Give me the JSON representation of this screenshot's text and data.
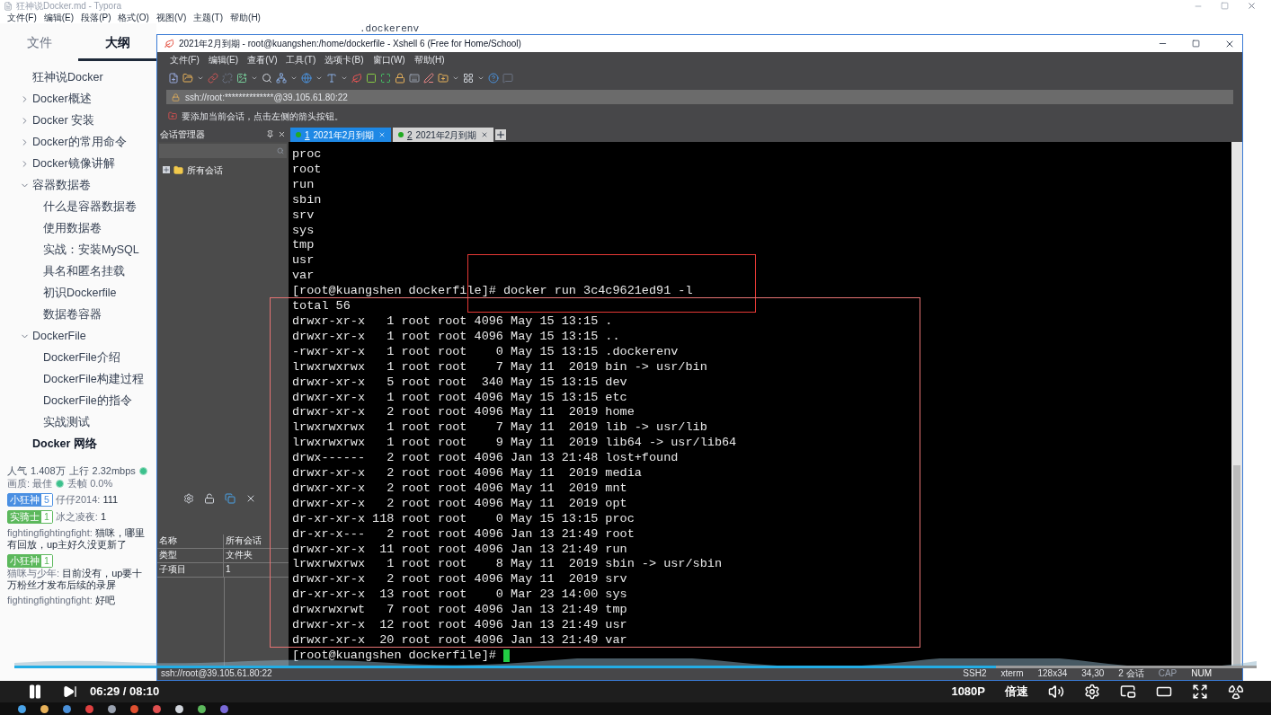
{
  "typora": {
    "title": "狂神说Docker.md - Typora",
    "menu": [
      "文件(F)",
      "编辑(E)",
      "段落(P)",
      "格式(O)",
      "视图(V)",
      "主题(T)",
      "帮助(H)"
    ],
    "sidebar_tabs": [
      {
        "label": "文件",
        "selected": false
      },
      {
        "label": "大纲",
        "selected": true
      }
    ],
    "outline": [
      {
        "label": "狂神说Docker",
        "kind": "heading",
        "selected": false
      },
      {
        "label": "Docker概述",
        "kind": "folder",
        "expanded": false,
        "selected": false
      },
      {
        "label": "Docker 安装",
        "kind": "folder",
        "expanded": false,
        "selected": false
      },
      {
        "label": "Docker的常用命令",
        "kind": "folder",
        "expanded": false,
        "selected": false
      },
      {
        "label": "Docker镜像讲解",
        "kind": "folder",
        "expanded": false,
        "selected": false
      },
      {
        "label": "容器数据卷",
        "kind": "folder",
        "expanded": true,
        "selected": false,
        "children": [
          {
            "label": "什么是容器数据卷",
            "selected": false
          },
          {
            "label": "使用数据卷",
            "selected": false
          },
          {
            "label": "实战：安装MySQL",
            "selected": false
          },
          {
            "label": "具名和匿名挂载",
            "selected": false
          },
          {
            "label": "初识Dockerfile",
            "selected": false
          },
          {
            "label": "数据卷容器",
            "selected": false
          }
        ]
      },
      {
        "label": "DockerFile",
        "kind": "folder",
        "expanded": true,
        "selected": false,
        "children": [
          {
            "label": "DockerFile介绍",
            "selected": false
          },
          {
            "label": "DockerFile构建过程",
            "selected": false
          },
          {
            "label": "DockerFile的指令",
            "selected": false
          },
          {
            "label": "实战测试",
            "selected": false
          }
        ]
      },
      {
        "label": "Docker 网络",
        "kind": "heading",
        "selected": true
      }
    ],
    "content_text": ".dockerenv"
  },
  "live_stats": {
    "popularity_label": "人气",
    "popularity": "1.408万",
    "upload_label": "上行",
    "upload": "2.32mbps",
    "quality": "画质: 最佳",
    "drop": "丢帧 0.0%"
  },
  "chat": [
    {
      "badge": {
        "text": "小狂神",
        "level": "5",
        "color": "#4a8fe2"
      },
      "user": "仔仔2014:",
      "text": "111"
    },
    {
      "badge": {
        "text": "实骑士",
        "level": "1",
        "color": "#5cb85c"
      },
      "user": "冰之凌夜:",
      "text": "1"
    },
    {
      "user": "fightingfightingfight:",
      "text": "猫咪，哪里有回放，up主好久没更新了"
    },
    {
      "badge": {
        "text": "小狂神",
        "level": "1",
        "color": "#5cb85c"
      },
      "user": "猫咪与少年:",
      "text": "目前没有，up要十万粉丝才发布后续的录屏"
    },
    {
      "user": "fightingfightingfight:",
      "text": "好吧"
    }
  ],
  "xshell": {
    "title": "2021年2月到期 - root@kuangshen:/home/dockerfile - Xshell 6 (Free for Home/School)",
    "menu": [
      "文件(F)",
      "编辑(E)",
      "查看(V)",
      "工具(T)",
      "选项卡(B)",
      "窗口(W)",
      "帮助(H)"
    ],
    "address": "ssh://root:**************@39.105.61.80:22",
    "hint": "要添加当前会话，点击左侧的箭头按钮。",
    "session_panel": {
      "title": "会话管理器",
      "tree": [
        {
          "label": "所有会话",
          "expanded": false
        }
      ],
      "properties": [
        {
          "name": "名称",
          "value": "所有会话"
        },
        {
          "name": "类型",
          "value": "文件夹"
        },
        {
          "name": "子项目",
          "value": "1"
        }
      ]
    },
    "tabs": [
      {
        "number": "1",
        "label": "2021年2月到期",
        "selected": true
      },
      {
        "number": "2",
        "label": "2021年2月到期",
        "selected": false
      }
    ],
    "terminal": {
      "lines": [
        "proc",
        "root",
        "run",
        "sbin",
        "srv",
        "sys",
        "tmp",
        "usr",
        "var",
        "[root@kuangshen dockerfile]# docker run 3c4c9621ed91 -l",
        "total 56",
        "drwxr-xr-x   1 root root 4096 May 15 13:15 .",
        "drwxr-xr-x   1 root root 4096 May 15 13:15 ..",
        "-rwxr-xr-x   1 root root    0 May 15 13:15 .dockerenv",
        "lrwxrwxrwx   1 root root    7 May 11  2019 bin -> usr/bin",
        "drwxr-xr-x   5 root root  340 May 15 13:15 dev",
        "drwxr-xr-x   1 root root 4096 May 15 13:15 etc",
        "drwxr-xr-x   2 root root 4096 May 11  2019 home",
        "lrwxrwxrwx   1 root root    7 May 11  2019 lib -> usr/lib",
        "lrwxrwxrwx   1 root root    9 May 11  2019 lib64 -> usr/lib64",
        "drwx------   2 root root 4096 Jan 13 21:48 lost+found",
        "drwxr-xr-x   2 root root 4096 May 11  2019 media",
        "drwxr-xr-x   2 root root 4096 May 11  2019 mnt",
        "drwxr-xr-x   2 root root 4096 May 11  2019 opt",
        "dr-xr-xr-x 118 root root    0 May 15 13:15 proc",
        "dr-xr-x---   2 root root 4096 Jan 13 21:49 root",
        "drwxr-xr-x  11 root root 4096 Jan 13 21:49 run",
        "lrwxrwxrwx   1 root root    8 May 11  2019 sbin -> usr/sbin",
        "drwxr-xr-x   2 root root 4096 May 11  2019 srv",
        "dr-xr-xr-x  13 root root    0 Mar 23 14:00 sys",
        "drwxrwxrwt   7 root root 4096 Jan 13 21:49 tmp",
        "drwxr-xr-x  12 root root 4096 Jan 13 21:49 usr",
        "drwxr-xr-x  20 root root 4096 Jan 13 21:49 var"
      ],
      "prompt": "[root@kuangshen dockerfile]# "
    },
    "status": {
      "address": "ssh://root@39.105.61.80:22",
      "protocol": "SSH2",
      "terminal": "xterm",
      "size": "128x34",
      "cursor": "34,30",
      "sessions": "2 会话",
      "caps_lock": {
        "label": "CAP",
        "on": false
      },
      "num_lock": {
        "label": "NUM",
        "on": true
      }
    }
  },
  "player": {
    "time": "06:29 / 08:10",
    "progress": {
      "level": 0.79
    },
    "quality": "1080P",
    "speed": "倍速"
  }
}
